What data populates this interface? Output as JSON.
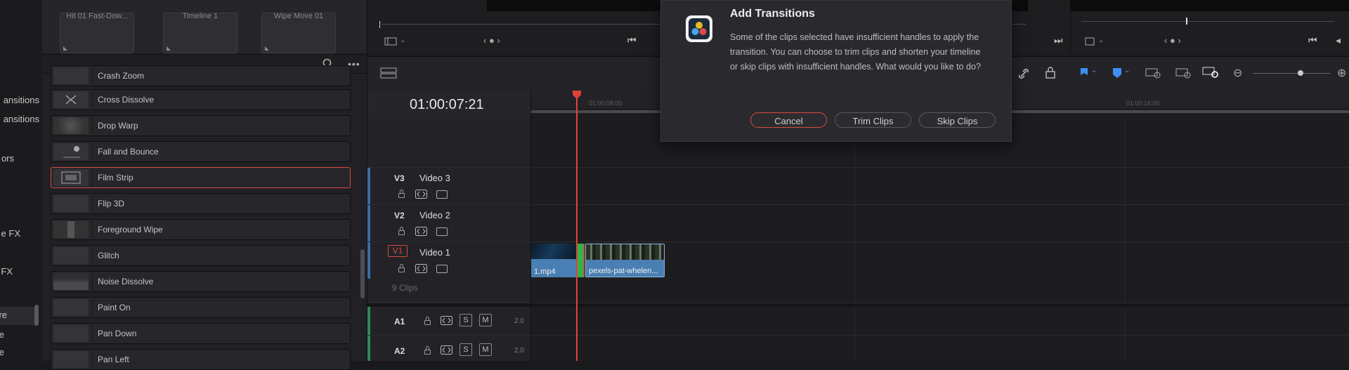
{
  "left_categories": [
    {
      "label": "ansitions",
      "selected": false
    },
    {
      "label": "ansitions",
      "selected": false
    },
    {
      "label": "ors",
      "selected": false
    },
    {
      "label": "e FX",
      "selected": false
    },
    {
      "label": "FX",
      "selected": false
    },
    {
      "label": "re",
      "selected": true
    },
    {
      "label": "e",
      "selected": false
    },
    {
      "label": "e",
      "selected": false
    }
  ],
  "presets": [
    {
      "label": "Hit 01 Fast-Dow..."
    },
    {
      "label": "Timeline 1"
    },
    {
      "label": "Wipe Move 01"
    }
  ],
  "transitions": [
    {
      "label": "Crash Zoom",
      "selected": false
    },
    {
      "label": "Cross Dissolve",
      "selected": false
    },
    {
      "label": "Drop Warp",
      "selected": false
    },
    {
      "label": "Fall and Bounce",
      "selected": false
    },
    {
      "label": "Film Strip",
      "selected": true
    },
    {
      "label": "Flip 3D",
      "selected": false
    },
    {
      "label": "Foreground Wipe",
      "selected": false
    },
    {
      "label": "Glitch",
      "selected": false
    },
    {
      "label": "Noise Dissolve",
      "selected": false
    },
    {
      "label": "Paint On",
      "selected": false
    },
    {
      "label": "Pan Down",
      "selected": false
    },
    {
      "label": "Pan Left",
      "selected": false
    }
  ],
  "timecode": "01:00:07:21",
  "ruler_labels": [
    "01:00:08:00",
    "01:00:16:00"
  ],
  "tracks": {
    "v3": {
      "id": "V3",
      "name": "Video 3"
    },
    "v2": {
      "id": "V2",
      "name": "Video 2"
    },
    "v1": {
      "id": "V1",
      "name": "Video 1"
    },
    "clips_count": "9 Clips",
    "a1": {
      "id": "A1",
      "level": "2.0"
    },
    "a2": {
      "id": "A2",
      "level": "2.0"
    },
    "solo": "S",
    "mute": "M"
  },
  "clips": [
    {
      "label": "1.mp4"
    },
    {
      "label": "pexels-pat-whelen..."
    }
  ],
  "dialog": {
    "title": "Add Transitions",
    "message": "Some of the clips selected have insufficient handles to apply the transition. You can choose to trim clips and shorten your timeline or skip clips with insufficient handles. What would you like to do?",
    "cancel": "Cancel",
    "trim": "Trim Clips",
    "skip": "Skip Clips"
  },
  "colors": {
    "accent_red": "#d7493f",
    "clip_blue": "#4a7fb3",
    "flag_blue": "#3d8ef5"
  }
}
